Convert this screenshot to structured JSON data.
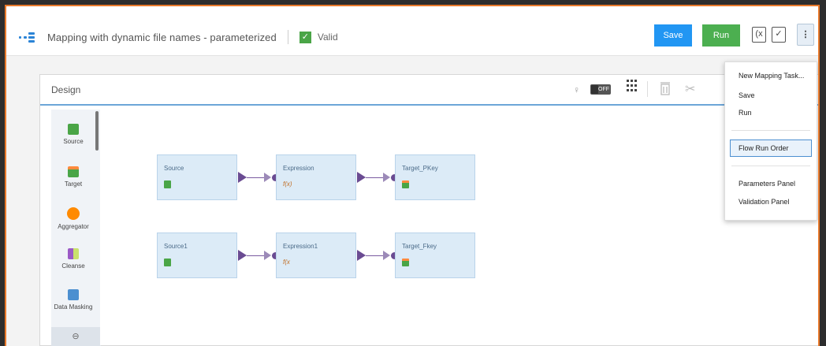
{
  "header": {
    "mapping_title": "Mapping with dynamic file names - parameterized",
    "valid_check": "✓",
    "valid_label": "Valid",
    "save_label": "Save",
    "run_label": "Run",
    "icon1_glyph": "(x",
    "icon2_glyph": "✓",
    "more_glyph": "⋮"
  },
  "design": {
    "title": "Design",
    "toggle_label": "OFF"
  },
  "palette": {
    "items": [
      {
        "label": "Source",
        "color": "#4aa547"
      },
      {
        "label": "Target",
        "color": "#ff8a3d"
      },
      {
        "label": "Aggregator",
        "color": "#ff8a00"
      },
      {
        "label": "Cleanse",
        "color": "#9b59c6"
      },
      {
        "label": "Data Masking",
        "color": "#4c8fd0"
      }
    ]
  },
  "canvas": {
    "row1": [
      "Source",
      "Expression",
      "Target_PKey"
    ],
    "row2": [
      "Source1",
      "Expression1",
      "Target_Fkey"
    ],
    "expr_icon": "f(x)",
    "expr_icon_short": "f(x"
  },
  "menu": {
    "items": [
      "New Mapping Task...",
      "Save",
      "Run",
      "Flow Run Order",
      "Parameters Panel",
      "Validation Panel"
    ]
  },
  "colors": {
    "accent_blue": "#2196f3",
    "run_green": "#4caf50",
    "frame_orange": "#e8792b",
    "link_purple": "#6a4b92"
  }
}
